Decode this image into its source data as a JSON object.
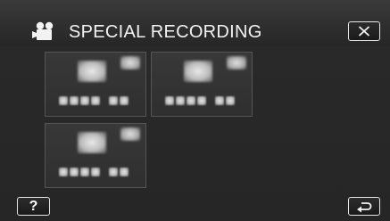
{
  "header": {
    "title": "SPECIAL RECORDING",
    "title_icon": "movie-camera-icon",
    "close_icon": "close-x-icon"
  },
  "grid": {
    "tiles": [
      {
        "state": "blurred"
      },
      {
        "state": "blurred"
      },
      {
        "state": "blurred"
      }
    ]
  },
  "footer": {
    "help_label": "?",
    "back_icon": "return-arrow-icon"
  },
  "colors": {
    "background": "#262626",
    "header": "#333333",
    "text": "#f2f2f2",
    "button_border": "#e6e6e6"
  }
}
